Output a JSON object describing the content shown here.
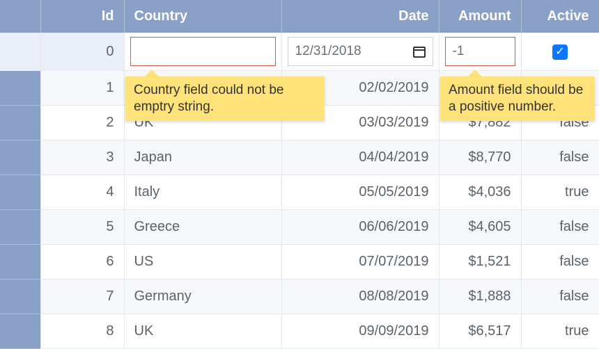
{
  "headers": {
    "id": "Id",
    "country": "Country",
    "date": "Date",
    "amount": "Amount",
    "active": "Active"
  },
  "editRow": {
    "id": "0",
    "country": "",
    "dateDisplay": "12/31/2018",
    "amount": "-1",
    "activeChecked": true
  },
  "rows": [
    {
      "id": "1",
      "country": "",
      "date": "02/02/2019",
      "amount": "",
      "active": ""
    },
    {
      "id": "2",
      "country": "UK",
      "date": "03/03/2019",
      "amount": "$7,882",
      "active": "false"
    },
    {
      "id": "3",
      "country": "Japan",
      "date": "04/04/2019",
      "amount": "$8,770",
      "active": "false"
    },
    {
      "id": "4",
      "country": "Italy",
      "date": "05/05/2019",
      "amount": "$4,036",
      "active": "true"
    },
    {
      "id": "5",
      "country": "Greece",
      "date": "06/06/2019",
      "amount": "$4,605",
      "active": "false"
    },
    {
      "id": "6",
      "country": "US",
      "date": "07/07/2019",
      "amount": "$1,521",
      "active": "false"
    },
    {
      "id": "7",
      "country": "Germany",
      "date": "08/08/2019",
      "amount": "$1,888",
      "active": "false"
    },
    {
      "id": "8",
      "country": "UK",
      "date": "09/09/2019",
      "amount": "$6,517",
      "active": "true"
    }
  ],
  "tooltips": {
    "country": "Country field could not be emptry string.",
    "amount": "Amount field should be a positive number."
  }
}
